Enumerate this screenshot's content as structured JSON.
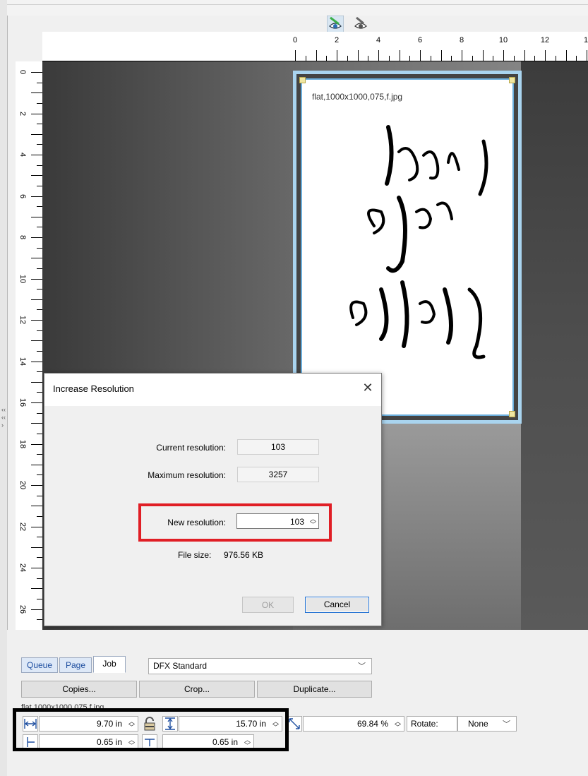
{
  "ruler": {
    "horizontal": [
      "0",
      "2",
      "4",
      "6",
      "8",
      "10",
      "12",
      "1"
    ],
    "vertical": [
      "0",
      "2",
      "4",
      "6",
      "8",
      "10",
      "12",
      "14",
      "16",
      "18",
      "20",
      "22",
      "24",
      "26"
    ]
  },
  "page": {
    "filename": "flat,1000x1000,075,f.jpg"
  },
  "dialog": {
    "title": "Increase Resolution",
    "close": "✕",
    "current_label": "Current resolution:",
    "current_value": "103",
    "max_label": "Maximum resolution:",
    "max_value": "3257",
    "new_label": "New resolution:",
    "new_value": "103",
    "filesize_label": "File size:",
    "filesize_value": "976.56 KB",
    "ok": "OK",
    "cancel": "Cancel"
  },
  "tabs": [
    {
      "label": "Queue"
    },
    {
      "label": "Page"
    },
    {
      "label": "Job"
    }
  ],
  "preset": {
    "value": "DFX Standard"
  },
  "buttons": {
    "copies": "Copies...",
    "crop": "Crop...",
    "duplicate": "Duplicate..."
  },
  "bottom": {
    "filename": "flat,1000x1000,075,f.jpg",
    "width": "9.70 in",
    "height": "15.70 in",
    "scale": "69.84 %",
    "rotate_label": "Rotate:",
    "rotate_value": "None",
    "offset_x": "0.65 in",
    "offset_y": "0.65 in"
  },
  "icons": {
    "eye1": "eye-brush-icon",
    "eye2": "eye-pen-icon",
    "lock": "lock-icon",
    "width": "width-arrow-icon",
    "height": "height-arrow-icon",
    "scale": "scale-diagonal-icon"
  },
  "colors": {
    "highlight_red": "#e01e25",
    "highlight_black": "#000000",
    "page_border": "#6aaedc"
  }
}
